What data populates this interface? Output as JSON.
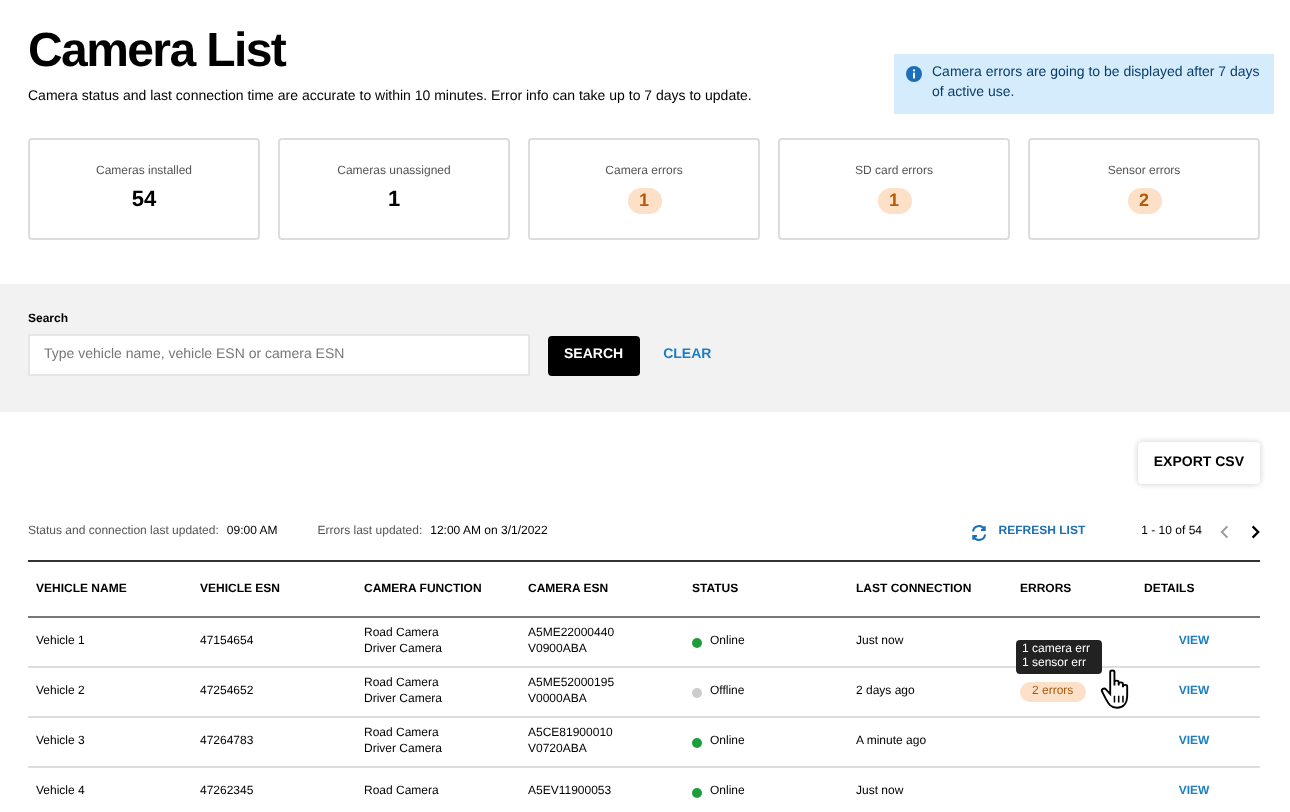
{
  "title": "Camera List",
  "subtitle": "Camera status and last connection time are accurate to within 10 minutes. Error info can take up to 7 days to update.",
  "info_banner": "Camera errors are going to be displayed after 7 days of active use.",
  "stats": [
    {
      "label": "Cameras installed",
      "value": "54",
      "kind": "plain"
    },
    {
      "label": "Cameras unassigned",
      "value": "1",
      "kind": "plain"
    },
    {
      "label": "Camera errors",
      "value": "1",
      "kind": "badge"
    },
    {
      "label": "SD card errors",
      "value": "1",
      "kind": "badge"
    },
    {
      "label": "Sensor errors",
      "value": "2",
      "kind": "badge"
    }
  ],
  "search": {
    "label": "Search",
    "placeholder": "Type vehicle name, vehicle ESN or camera ESN",
    "button": "SEARCH",
    "clear": "CLEAR"
  },
  "export_button": "EXPORT CSV",
  "meta": {
    "status_label": "Status and connection last updated:",
    "status_value": "09:00 AM",
    "errors_label": "Errors last updated:",
    "errors_value": "12:00 AM on 3/1/2022",
    "refresh": "REFRESH LIST",
    "pagination": "1 - 10 of 54"
  },
  "table": {
    "columns": [
      "VEHICLE NAME",
      "VEHICLE ESN",
      "CAMERA FUNCTION",
      "CAMERA ESN",
      "STATUS",
      "LAST CONNECTION",
      "ERRORS",
      "DETAILS"
    ],
    "rows": [
      {
        "vehicle": "Vehicle 1",
        "esn": "47154654",
        "functions": [
          "Road Camera",
          "Driver Camera"
        ],
        "camera_esns": [
          "A5ME22000440",
          "V0900ABA"
        ],
        "status": "Online",
        "online": true,
        "last": "Just now",
        "details": "VIEW"
      },
      {
        "vehicle": "Vehicle 2",
        "esn": "47254652",
        "functions": [
          "Road Camera",
          "Driver Camera"
        ],
        "camera_esns": [
          "A5ME52000195",
          "V0000ABA"
        ],
        "status": "Offline",
        "online": false,
        "last": "2 days ago",
        "errors": "2 errors",
        "tooltip": [
          "1 camera err",
          "1 sensor err"
        ],
        "details": "VIEW"
      },
      {
        "vehicle": "Vehicle 3",
        "esn": "47264783",
        "functions": [
          "Road Camera",
          "Driver Camera"
        ],
        "camera_esns": [
          "A5CE81900010",
          "V0720ABA"
        ],
        "status": "Online",
        "online": true,
        "last": "A minute ago",
        "details": "VIEW"
      },
      {
        "vehicle": "Vehicle 4",
        "esn": "47262345",
        "functions": [
          "Road Camera"
        ],
        "camera_esns": [
          "A5EV11900053"
        ],
        "status": "Online",
        "online": true,
        "last": "Just now",
        "details": "VIEW"
      }
    ]
  }
}
